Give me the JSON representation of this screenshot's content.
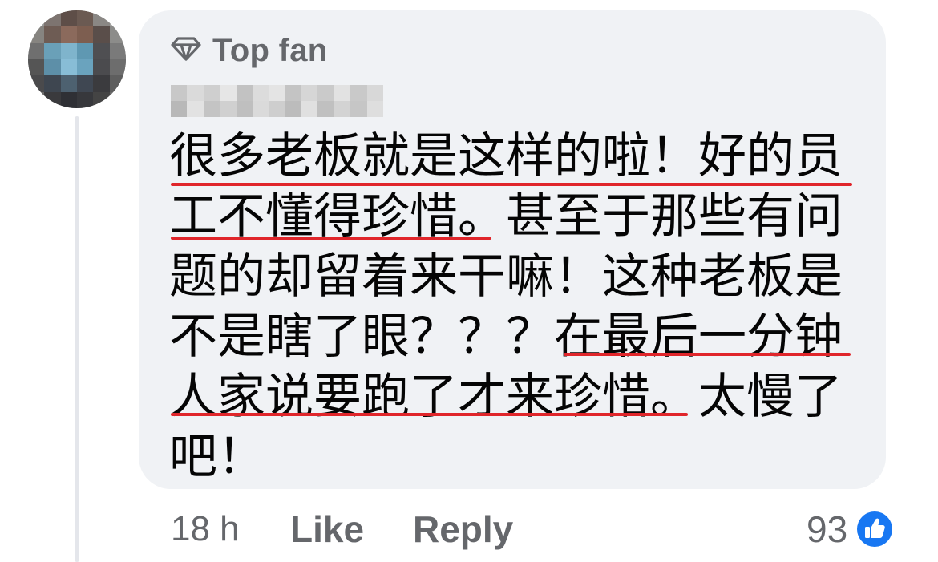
{
  "comment": {
    "badge_label": "Top fan",
    "badge_icon": "diamond-icon",
    "author_name_state": "pixelated",
    "avatar_state": "pixelated",
    "text_lines": [
      "很多老板就是这样的啦！好的员",
      "工不懂得珍惜。甚至于那些有问",
      "题的却留着来干嘛！这种老板是",
      "不是瞎了眼？？？在最后一分钟",
      "人家说要跑了才来珍惜。太慢了",
      "吧！"
    ],
    "underline_color": "#e0262b"
  },
  "actions": {
    "timestamp": "18 h",
    "like_label": "Like",
    "reply_label": "Reply"
  },
  "reactions": {
    "count": "93",
    "icon": "thumbs-up-icon",
    "color": "#1877f2"
  },
  "colors": {
    "bubble": "#f0f2f5",
    "text": "#050505",
    "secondary": "#65676b"
  }
}
